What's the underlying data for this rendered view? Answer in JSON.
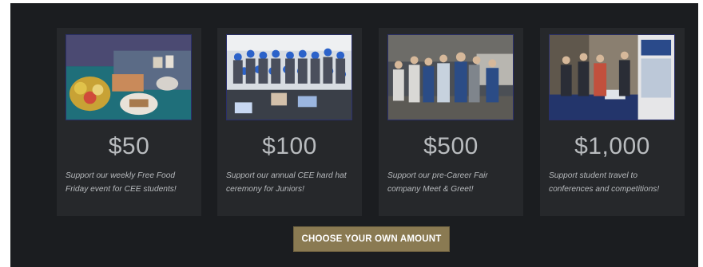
{
  "page": {
    "cta_label": "CHOOSE YOUR OWN AMOUNT"
  },
  "cards": [
    {
      "amount": "$50",
      "description": "Support our weekly Free Food Friday event for CEE students!",
      "photo_icon": "food-table-photo"
    },
    {
      "amount": "$100",
      "description": "Support our annual CEE hard hat ceremony for Juniors!",
      "photo_icon": "hard-hat-group-photo"
    },
    {
      "amount": "$500",
      "description": "Support our pre-Career Fair company Meet & Greet!",
      "photo_icon": "meet-and-greet-photo"
    },
    {
      "amount": "$1,000",
      "description": "Support student travel to conferences and competitions!",
      "photo_icon": "conference-booth-photo"
    }
  ],
  "colors": {
    "panel_bg": "#1b1d20",
    "card_bg": "#26282b",
    "cta_bg": "#8a7a52",
    "text": "#b9bcbf"
  }
}
